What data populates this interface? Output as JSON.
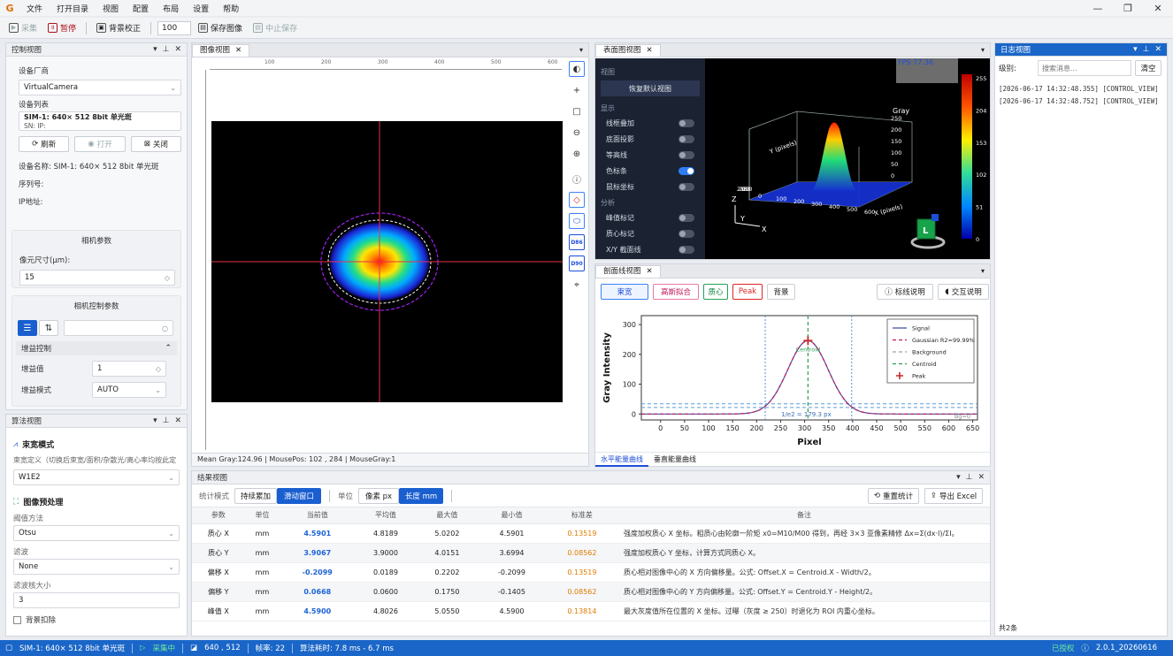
{
  "app": {
    "menu": [
      "文件",
      "打开目录",
      "视图",
      "配置",
      "布局",
      "设置",
      "帮助"
    ]
  },
  "toolbar": {
    "capture": "采集",
    "pause": "暂停",
    "bg_correct": "背景校正",
    "count": "100",
    "save_image": "保存图像",
    "stop_save": "中止保存"
  },
  "control": {
    "title": "控制视图",
    "vendor_label": "设备厂商",
    "vendor": "VirtualCamera",
    "devlist_label": "设备列表",
    "device": "SIM-1: 640× 512  8bit  单光斑",
    "sn": "SN:   IP:",
    "refresh": "刷新",
    "open": "打开",
    "close": "关闭",
    "name_line": "设备名称:  SIM-1: 640× 512  8bit  单光斑",
    "serial_line": "序列号:",
    "ip_line": "IP地址:",
    "cam_params": "相机参数",
    "pixel_label": "像元尺寸(μm):",
    "pixel_value": "15",
    "cam_ctrl": "相机控制参数",
    "gain_ctrl": "增益控制",
    "gain_label": "增益值",
    "gain_value": "1",
    "gain_mode_label": "增益模式",
    "gain_mode": "AUTO"
  },
  "algo": {
    "title": "算法视图",
    "beam_mode": "束宽模式",
    "beam_def": "束宽定义（切换后束宽/面积/杂散光/离心率均按此定",
    "beam_value": "W1E2",
    "preproc": "图像预处理",
    "thresh_label": "阈值方法",
    "thresh": "Otsu",
    "filter_label": "滤波",
    "filter": "None",
    "kernel_label": "滤波核大小",
    "kernel": "3",
    "bg_sub": "背景扣除"
  },
  "image": {
    "tab": "图像视图",
    "ruler": [
      "100",
      "200",
      "300",
      "400",
      "500",
      "600"
    ],
    "status": "Mean Gray:124.96 | MousePos: 102 , 284 | MouseGray:1"
  },
  "surface": {
    "tab": "表面图视图",
    "sec_view": "视图",
    "reset": "恢复默认视图",
    "sec_display": "显示",
    "opts": [
      {
        "label": "线框叠加",
        "on": false
      },
      {
        "label": "底面投影",
        "on": false
      },
      {
        "label": "等高线",
        "on": false
      },
      {
        "label": "色标条",
        "on": true
      },
      {
        "label": "鼠标坐标",
        "on": false
      }
    ],
    "sec_analysis": "分析",
    "opts2": [
      {
        "label": "峰值标记",
        "on": false
      },
      {
        "label": "质心标记",
        "on": false
      },
      {
        "label": "X/Y 截面线",
        "on": false
      }
    ],
    "fps": "FPS:77.36",
    "colorbar": [
      "255",
      "204",
      "153",
      "102",
      "51",
      "0"
    ],
    "axis_gray": "Gray",
    "axis_y": "Y (pixels)",
    "axis_x": "X (pixels)",
    "zticks": [
      "250",
      "200",
      "150",
      "100",
      "50",
      "0"
    ],
    "xticks": [
      "0",
      "100",
      "200",
      "300",
      "400",
      "500",
      "600"
    ],
    "yticks": [
      "0",
      "50",
      "100",
      "150",
      "200",
      "250"
    ],
    "ax_z": "Z",
    "ax_y": "Y",
    "ax_x": "X",
    "cube": "L"
  },
  "profile": {
    "tab": "剖面线视图",
    "buttons": [
      "束宽",
      "高斯拟合",
      "质心",
      "Peak",
      "背景"
    ],
    "legend_btn": "标线说明",
    "interact_btn": "交互说明",
    "tabs": [
      "水平能量曲线",
      "垂直能量曲线"
    ]
  },
  "chart_data": {
    "type": "line",
    "xlabel": "Pixel",
    "ylabel": "Gray Intensity",
    "xlim": [
      -40,
      660
    ],
    "ylim": [
      -20,
      330
    ],
    "xticks": [
      0,
      50,
      100,
      150,
      200,
      250,
      300,
      350,
      400,
      450,
      500,
      550,
      600,
      650
    ],
    "yticks": [
      0,
      100,
      200,
      300
    ],
    "series": [
      {
        "name": "Signal",
        "color": "#4457a6",
        "center": 307,
        "sigma": 42,
        "amp": 246,
        "base": 0
      },
      {
        "name": "Gaussian  R2=99.99%",
        "color": "#c2185b",
        "center": 307,
        "sigma": 42,
        "amp": 246,
        "base": 0
      },
      {
        "name": "Background",
        "color": "#9aa4b2",
        "level": 0
      },
      {
        "name": "Centroid",
        "color": "#2e9b57",
        "x": 307
      }
    ],
    "peak": {
      "name": "Peak",
      "x": 307,
      "y": 246
    },
    "annot": {
      "centroid": "Centroid",
      "width": "1/e2 = 179.3 px",
      "bg": "Bg=0"
    },
    "bounds": [
      218,
      398
    ],
    "legend": "top-right",
    "grid": false
  },
  "results": {
    "title": "结果视图",
    "mode_label": "统计模式",
    "mode_a": "持续累加",
    "mode_b": "滑动窗口",
    "unit_label": "单位",
    "unit_px": "像素 px",
    "unit_mm": "长度 mm",
    "reset": "重置统计",
    "export": "导出 Excel",
    "headers": [
      "参数",
      "单位",
      "当前值",
      "平均值",
      "最大值",
      "最小值",
      "标准差",
      "备注"
    ],
    "rows": [
      [
        "质心 X",
        "mm",
        "4.5901",
        "4.8189",
        "5.0202",
        "4.5901",
        "0.13519",
        "强度加权质心 X 坐标。粗质心由轮廓一阶矩 x0=M10/M00 得到，再经 3×3 亚像素精修 Δx=Σ(dx·I)/ΣI。"
      ],
      [
        "质心 Y",
        "mm",
        "3.9067",
        "3.9000",
        "4.0151",
        "3.6994",
        "0.08562",
        "强度加权质心 Y 坐标，计算方式同质心 X。"
      ],
      [
        "偏移 X",
        "mm",
        "-0.2099",
        "0.0189",
        "0.2202",
        "-0.2099",
        "0.13519",
        "质心相对图像中心的 X 方向偏移量。公式: Offset.X = Centroid.X - Width/2。"
      ],
      [
        "偏移 Y",
        "mm",
        "0.0668",
        "0.0600",
        "0.1750",
        "-0.1405",
        "0.08562",
        "质心相对图像中心的 Y 方向偏移量。公式: Offset.Y = Centroid.Y - Height/2。"
      ],
      [
        "峰值 X",
        "mm",
        "4.5900",
        "4.8026",
        "5.0550",
        "4.5900",
        "0.13814",
        "最大灰度值所在位置的 X 坐标。过曝（灰度 ≥ 250）时退化为 ROI 内重心坐标。"
      ]
    ]
  },
  "log": {
    "title": "日志视图",
    "level_label": "级别:",
    "search_placeholder": "搜索消息...",
    "clear": "清空",
    "lines": [
      "[2026-06-17 14:32:48.355]  [CONTROL_VIEW]",
      "[2026-06-17 14:32:48.752]  [CONTROL_VIEW]"
    ],
    "count": "共2条"
  },
  "status": {
    "device": "SIM-1: 640× 512  8bit  单光斑",
    "capturing": "采集中",
    "pos": "640 , 512",
    "fps": "帧率:  22",
    "algo": "算法耗时:  7.8 ms - 6.7 ms",
    "licensed": "已授权",
    "version": "2.0.1_20260616"
  }
}
